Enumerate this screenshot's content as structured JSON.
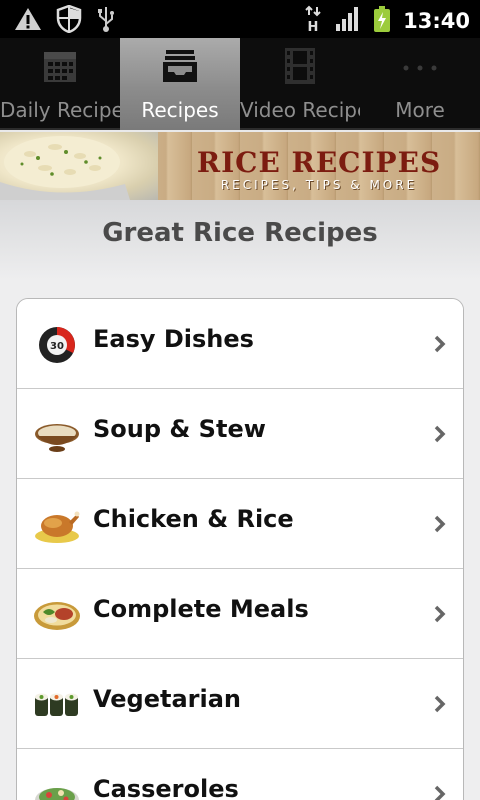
{
  "status_bar": {
    "time": "13:40",
    "left_icons": [
      "warning-icon",
      "shield-icon",
      "usb-icon"
    ],
    "right_icons": [
      "data-h-icon",
      "signal-icon",
      "battery-charging-icon"
    ]
  },
  "tabs": [
    {
      "label": "Daily Recipes",
      "icon": "calendar-icon",
      "active": false
    },
    {
      "label": "Recipes",
      "icon": "inbox-tray-icon",
      "active": true
    },
    {
      "label": "Video Recipe",
      "icon": "film-icon",
      "active": false
    },
    {
      "label": "More",
      "icon": "more-dots-icon",
      "active": false
    }
  ],
  "banner": {
    "title": "RICE RECIPES",
    "subtitle": "RECIPES, TIPS & MORE"
  },
  "heading": "Great Rice Recipes",
  "categories": [
    {
      "label": "Easy Dishes",
      "icon": "timer-30-icon"
    },
    {
      "label": "Soup & Stew",
      "icon": "soup-bowl-icon"
    },
    {
      "label": "Chicken & Rice",
      "icon": "roast-chicken-icon"
    },
    {
      "label": "Complete Meals",
      "icon": "meal-plate-icon"
    },
    {
      "label": "Vegetarian",
      "icon": "sushi-rolls-icon"
    },
    {
      "label": "Casseroles",
      "icon": "casserole-icon"
    }
  ],
  "colors": {
    "banner_title": "#7c1c10",
    "active_tab": "#9a9a9a"
  }
}
